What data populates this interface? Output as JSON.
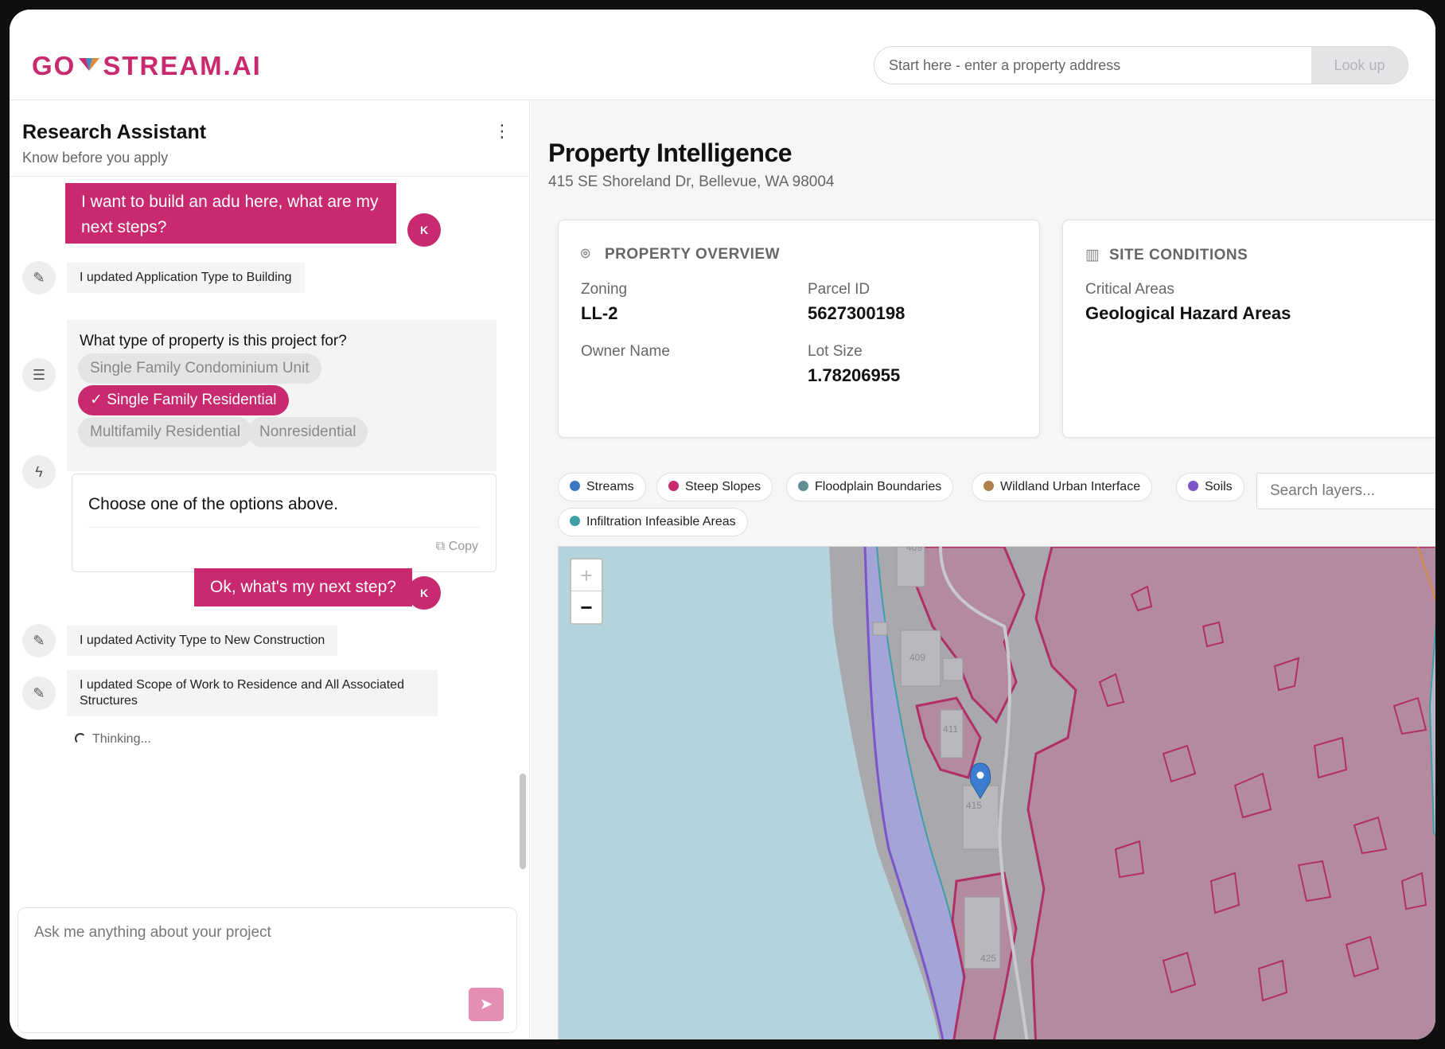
{
  "header": {
    "logo_text_left": "GO",
    "logo_text_right": "STREAM.AI",
    "search_placeholder": "Start here - enter a property address",
    "lookup_label": "Look up"
  },
  "assistant": {
    "title": "Research Assistant",
    "subtitle": "Know before you apply",
    "menu_icon": "kebab-icon",
    "messages": {
      "user1": "I want to build an adu here, what are my next steps?",
      "avatar_initial": "K",
      "update1": "I updated Application Type to Building",
      "question": "What type of property is this project for?",
      "options": [
        "Single Family Condominium Unit",
        "Single Family Residential",
        "Multifamily Residential",
        "Nonresidential"
      ],
      "selected_option": "Single Family Residential",
      "reply": "Choose one of the options above.",
      "copy_label": "Copy",
      "user2": "Ok, what's my next step?",
      "update2": "I updated Activity Type to New Construction",
      "update3": "I updated Scope of Work to Residence and All Associated Structures",
      "thinking": "Thinking..."
    },
    "composer_placeholder": "Ask me anything about your project"
  },
  "property": {
    "title": "Property Intelligence",
    "address": "415 SE Shoreland Dr, Bellevue, WA 98004",
    "overview": {
      "heading": "PROPERTY OVERVIEW",
      "zoning_label": "Zoning",
      "zoning_value": "LL-2",
      "parcel_label": "Parcel ID",
      "parcel_value": "5627300198",
      "owner_label": "Owner Name",
      "owner_value": "",
      "lot_label": "Lot Size",
      "lot_value": "1.78206955"
    },
    "site": {
      "heading": "SITE CONDITIONS",
      "critical_label": "Critical Areas",
      "critical_value": "Geological Hazard Areas"
    },
    "layers": [
      {
        "name": "Streams",
        "color": "#3b78c4"
      },
      {
        "name": "Steep Slopes",
        "color": "#c8296f"
      },
      {
        "name": "Floodplain Boundaries",
        "color": "#5f8f93"
      },
      {
        "name": "Wildland Urban Interface",
        "color": "#b07f4a"
      },
      {
        "name": "Soils",
        "color": "#7b55c9"
      },
      {
        "name": "Infiltration Infeasible Areas",
        "color": "#3f9fa8"
      }
    ],
    "layer_search_placeholder": "Search layers...",
    "map": {
      "zoom_in": "+",
      "zoom_out": "−",
      "parcel_labels": [
        "409",
        "411",
        "415",
        "425",
        "409",
        "42"
      ],
      "marker_icon": "map-pin-icon"
    }
  }
}
